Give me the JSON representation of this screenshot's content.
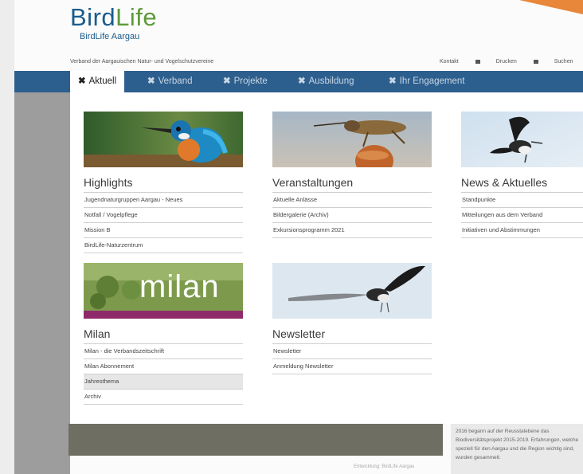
{
  "header": {
    "logo_main_a": "Bird",
    "logo_main_b": "Life",
    "logo_sub": "BirdLife Aargau",
    "tagline": "Verband der Aargauischen Natur- und Vogelschutzvereine",
    "tools": [
      {
        "label": "Kontakt",
        "icon": "mail-icon"
      },
      {
        "label": "Drucken",
        "icon": "print-icon"
      },
      {
        "label": "Suchen",
        "icon": "search-icon"
      }
    ]
  },
  "nav": {
    "tabs": [
      {
        "label": "Aktuell",
        "active": true
      },
      {
        "label": "Verband",
        "active": false
      },
      {
        "label": "Projekte",
        "active": false
      },
      {
        "label": "Ausbildung",
        "active": false
      },
      {
        "label": "Ihr Engagement",
        "active": false
      }
    ]
  },
  "menu": {
    "highlights": {
      "title": "Highlights",
      "image": "kingfisher-photo",
      "links": [
        "Jugendnaturgruppen Aargau - Neues",
        "Notfall / Vogelpflege",
        "Mission B",
        "BirdLife-Naturzentrum"
      ]
    },
    "veranstaltungen": {
      "title": "Veranstaltungen",
      "image": "grasshopper-photo",
      "links": [
        "Aktuelle Anlässe",
        "Bildergalerie (Archiv)",
        "Exkursionsprogramm 2021"
      ]
    },
    "news": {
      "title": "News & Aktuelles",
      "image": "bird-in-flight-photo",
      "links": [
        "Standpunkte",
        "Mitteilungen aus dem Verband",
        "Initiativen und Abstimmungen"
      ]
    },
    "milan": {
      "title": "Milan",
      "image_text": "milan",
      "links": [
        "Milan - die Verbandszeitschrift",
        "Milan Abonnement",
        "Jahresthema",
        "Archiv"
      ]
    },
    "newsletter": {
      "title": "Newsletter",
      "image": "wagtail-photo",
      "links": [
        "Newsletter",
        "Anmeldung Newsletter"
      ]
    }
  },
  "footer": {
    "text": "2016 begann auf der Reusstalebene das Biodiversitätsprojekt 2015-2019. Erfahrungen, welche speziell für den Aargau und die Region wichtig sind, wurden gesammelt.",
    "credit": "Entwicklung: BirdLife Aargau"
  }
}
